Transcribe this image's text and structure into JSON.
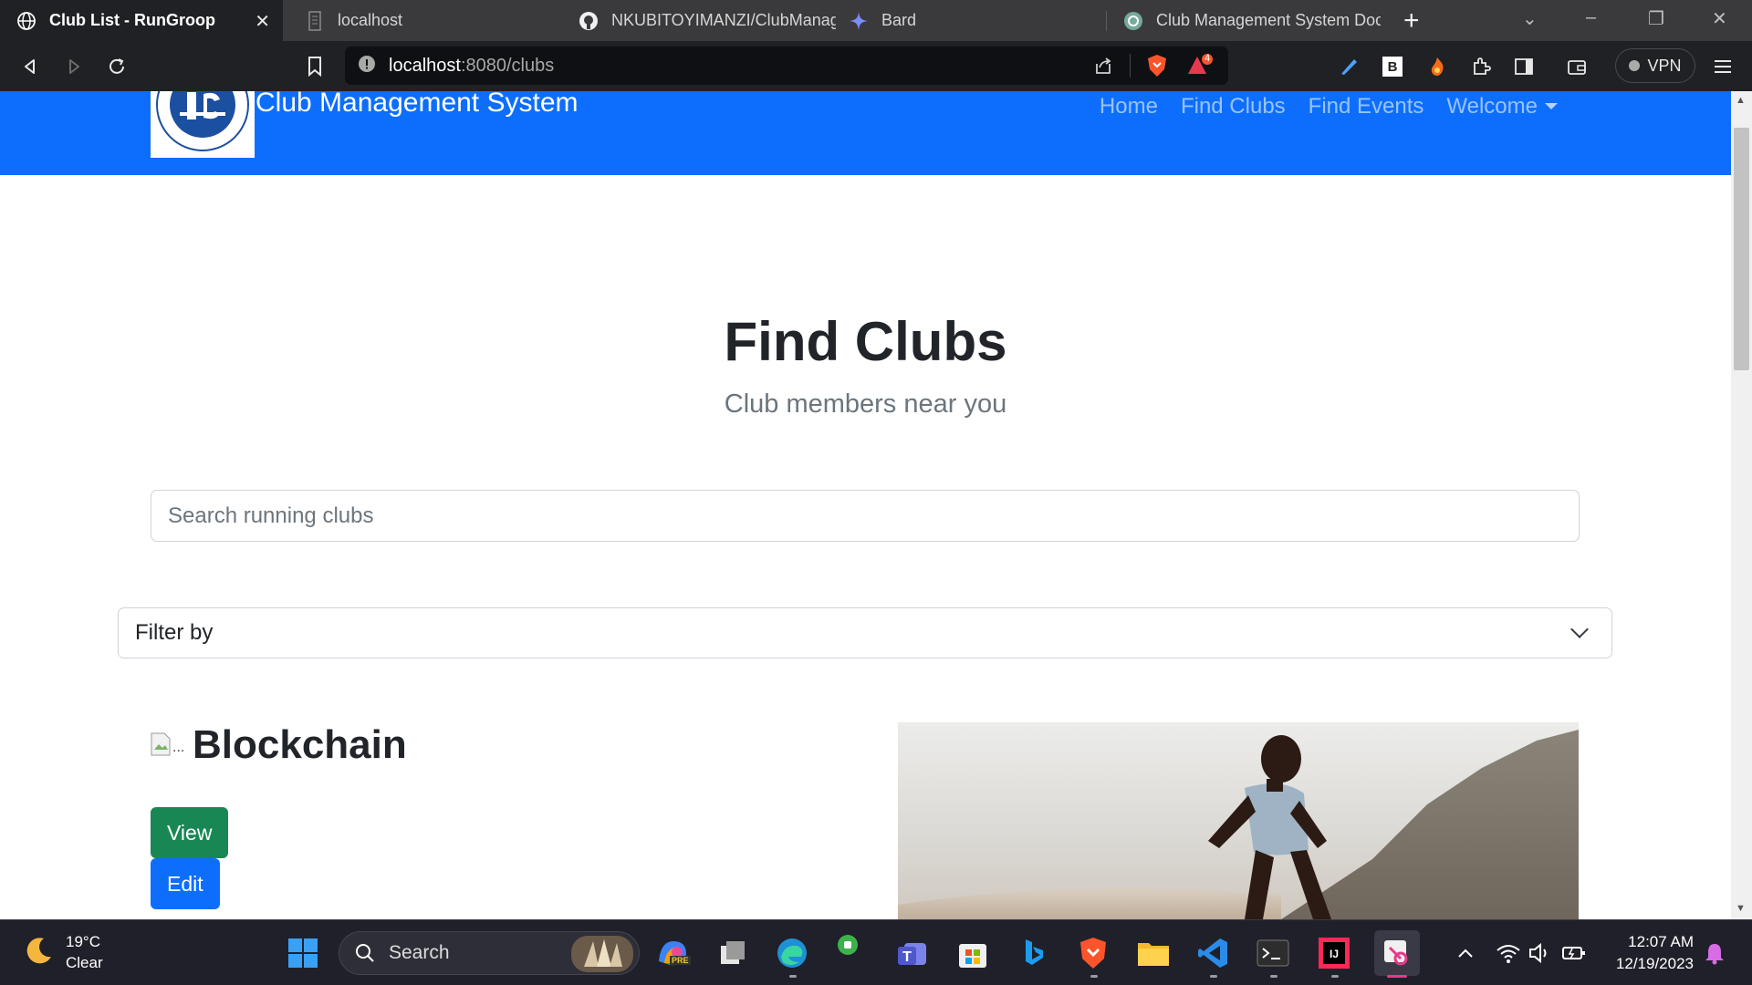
{
  "browser": {
    "tabs": [
      {
        "title": "Club List - RunGroop",
        "active": true,
        "icon": "globe-icon"
      },
      {
        "title": "localhost",
        "active": false,
        "icon": "page-icon"
      },
      {
        "title": "NKUBITOYIMANZI/ClubManag",
        "active": false,
        "icon": "github-icon"
      },
      {
        "title": "Bard",
        "active": false,
        "icon": "bard-sparkle-icon"
      },
      {
        "title": "Club Management System Doc",
        "active": false,
        "icon": "chatgpt-icon"
      }
    ],
    "url": {
      "host": "localhost",
      "rest": ":8080/clubs"
    },
    "shield_badge": "4",
    "extension_letter": "B",
    "vpn_label": "VPN"
  },
  "site": {
    "brand": "Club Management System",
    "nav": [
      "Home",
      "Find Clubs",
      "Find Events",
      "Welcome"
    ]
  },
  "hero": {
    "title": "Find Clubs",
    "subtitle": "Club members near you"
  },
  "search": {
    "placeholder": "Search running clubs",
    "value": ""
  },
  "filter": {
    "selected": "Filter by"
  },
  "clubs": [
    {
      "name": "Blockchain",
      "image_alt": "...",
      "view_label": "View",
      "edit_label": "Edit"
    }
  ],
  "taskbar": {
    "weather": {
      "temp": "19°C",
      "condition": "Clear"
    },
    "search_label": "Search",
    "copilot_badge": "PRE",
    "clock": {
      "time": "12:07 AM",
      "date": "12/19/2023"
    }
  },
  "colors": {
    "navbar": "#0d6efd",
    "view_button": "#198754",
    "edit_button": "#0d6efd",
    "browser_bg": "#202124"
  }
}
